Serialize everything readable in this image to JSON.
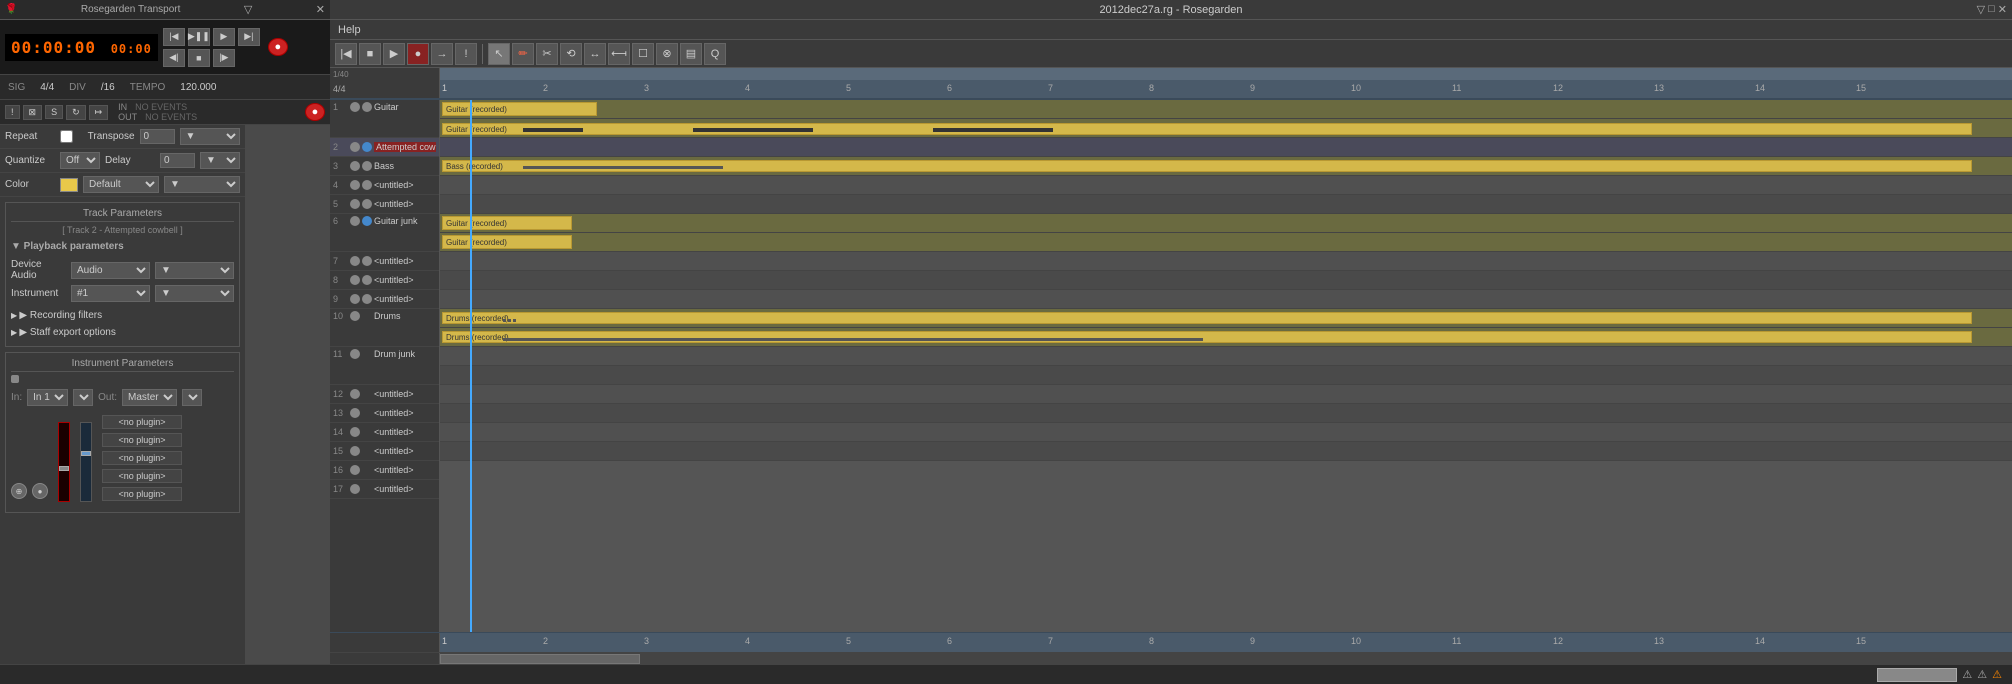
{
  "transport": {
    "title": "Rosegarden Transport",
    "time": "00:00:00",
    "time2": "00:00",
    "sig": "SIG",
    "sig_value": "4/4",
    "div": "DIV",
    "div_value": "/16",
    "tempo": "TEMPO",
    "tempo_value": "120.000",
    "in_label": "IN",
    "out_label": "OUT",
    "no_events": "NO EVENTS"
  },
  "main_title": "2012dec27a.rg - Rosegarden",
  "track_params": {
    "title": "Track Parameters",
    "subtitle": "[ Track 2 - Attempted cowbell ]",
    "playback_label": "▼ Playback parameters",
    "device_label": "Device Audio",
    "device_value": "Audio",
    "instrument_label": "Instrument",
    "instrument_value": "#1",
    "recording_filters": "▶ Recording filters",
    "staff_export": "▶ Staff export options"
  },
  "instrument_params": {
    "title": "Instrument Parameters",
    "in_label": "In:",
    "in_value": "In 1",
    "out_label": "Out:",
    "out_value": "Master",
    "plugins": [
      "<no plugin>",
      "<no plugin>",
      "<no plugin>",
      "<no plugin>",
      "<no plugin>"
    ]
  },
  "edit_params": {
    "repeat_label": "Repeat",
    "repeat_value": "",
    "transpose_label": "Transpose",
    "transpose_value": "0",
    "quantize_label": "Quantize",
    "quantize_value": "Off",
    "delay_label": "Delay",
    "delay_value": "0",
    "color_label": "Color",
    "color_value": "Default"
  },
  "tracks": [
    {
      "num": "1",
      "dot1": "grey",
      "dot2": "grey",
      "name": "Guitar",
      "has_segment": true,
      "segment_type": "yellow",
      "segment_label": "Guitar (recorded)"
    },
    {
      "num": "2",
      "dot1": "blue",
      "dot2": "blue",
      "name": "Attempted cowbell",
      "name_red": true,
      "has_segment": false
    },
    {
      "num": "3",
      "dot1": "grey",
      "dot2": "grey",
      "name": "Bass",
      "has_segment": true,
      "segment_type": "yellow",
      "segment_label": "Bass (recorded)"
    },
    {
      "num": "4",
      "dot1": "grey",
      "dot2": "grey",
      "name": "<untitled>",
      "has_segment": false
    },
    {
      "num": "5",
      "dot1": "grey",
      "dot2": "grey",
      "name": "<untitled>",
      "has_segment": false
    },
    {
      "num": "6",
      "dot1": "blue",
      "dot2": "blue",
      "name": "Guitar junk",
      "has_segment": false
    },
    {
      "num": "7",
      "dot1": "grey",
      "dot2": "grey",
      "name": "<untitled>",
      "has_segment": false
    },
    {
      "num": "8",
      "dot1": "grey",
      "dot2": "grey",
      "name": "<untitled>",
      "has_segment": false
    },
    {
      "num": "9",
      "dot1": "grey",
      "dot2": "grey",
      "name": "<untitled>",
      "has_segment": false
    },
    {
      "num": "10",
      "dot1": "grey",
      "dot2": "green",
      "name": "Drums",
      "has_segment": true,
      "segment_type": "yellow",
      "segment_label": "Drums (recorded)"
    },
    {
      "num": "11",
      "dot1": "grey",
      "dot2": "green",
      "name": "Drum junk",
      "has_segment": true,
      "segment_type": "yellow",
      "segment_label": "Drums (recorded)"
    },
    {
      "num": "12",
      "dot1": "grey",
      "dot2": "green",
      "name": "<untitled>",
      "has_segment": false
    },
    {
      "num": "13",
      "dot1": "grey",
      "dot2": "green",
      "name": "<untitled>",
      "has_segment": false
    },
    {
      "num": "14",
      "dot1": "grey",
      "dot2": "green",
      "name": "<untitled>",
      "has_segment": false
    },
    {
      "num": "15",
      "dot1": "grey",
      "dot2": "green",
      "name": "<untitled>",
      "has_segment": false
    },
    {
      "num": "16",
      "dot1": "grey",
      "dot2": "green",
      "name": "<untitled>",
      "has_segment": false
    }
  ],
  "ruler_marks": [
    "1",
    "2",
    "3",
    "4",
    "5",
    "6",
    "7",
    "8",
    "9",
    "10",
    "11",
    "12",
    "13",
    "14",
    "15"
  ],
  "toolbar": {
    "tools": [
      "▶|",
      "■",
      "●",
      "→|",
      "!",
      "↖",
      "✏",
      "✂",
      "⟲",
      "↔",
      "⟻",
      "☐",
      "⊗",
      "▤",
      "Q"
    ]
  }
}
